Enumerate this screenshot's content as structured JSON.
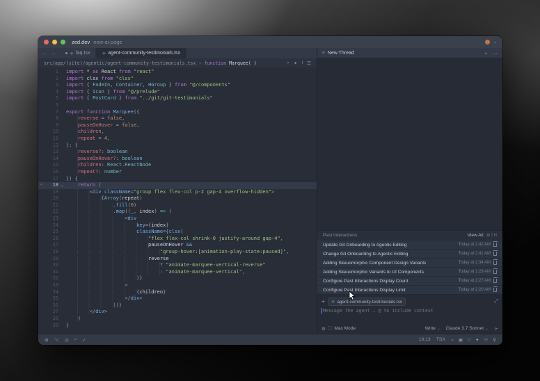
{
  "icons": {
    "back": "←",
    "forward": "→",
    "file_react": "⚛",
    "search": "⌕",
    "inline_assist": "✦",
    "cursor": "I",
    "editor_menu": "☰",
    "thread": "≡",
    "plus": "+",
    "more": "⋯",
    "expand": "⤢",
    "gear": "⚙",
    "max_mode": "⛶",
    "chevron_down": "⌄",
    "send": "➢",
    "avatar_chevron": "⌄",
    "fold_chevron": "⌄",
    "active_marker": "➤"
  },
  "titlebar": {
    "app": "zed.dev",
    "doc": "new-ai-page"
  },
  "tabs": [
    {
      "label": "faq.tsx",
      "modified": true,
      "active": false
    },
    {
      "label": "agent-community-testimonials.tsx",
      "modified": false,
      "active": true
    }
  ],
  "breadcrumb": {
    "path": "src/app/(site)/agentic/agent-community-testimonials.tsx",
    "separator": "›",
    "symbol_keyword": "function",
    "symbol_name": "Marquee( )"
  },
  "editor": {
    "lines": [
      {
        "n": 1,
        "t": [
          [
            "k",
            "import"
          ],
          [
            "v",
            " * "
          ],
          [
            "k",
            "as"
          ],
          [
            "v",
            " React "
          ],
          [
            "k",
            "from"
          ],
          [
            "s",
            " \"react\""
          ]
        ]
      },
      {
        "n": 2,
        "t": [
          [
            "k",
            "import"
          ],
          [
            "v",
            " clsx "
          ],
          [
            "k",
            "from"
          ],
          [
            "s",
            " \"clsx\""
          ]
        ]
      },
      {
        "n": 3,
        "t": [
          [
            "k",
            "import"
          ],
          [
            "g",
            " { "
          ],
          [
            "t",
            "FadeIn"
          ],
          [
            "g",
            ", "
          ],
          [
            "t",
            "Container"
          ],
          [
            "g",
            ", "
          ],
          [
            "t",
            "HGroup"
          ],
          [
            "g",
            " } "
          ],
          [
            "k",
            "from"
          ],
          [
            "s",
            " \"@/components\""
          ]
        ]
      },
      {
        "n": 4,
        "t": [
          [
            "k",
            "import"
          ],
          [
            "g",
            " { "
          ],
          [
            "t",
            "Icon"
          ],
          [
            "g",
            " } "
          ],
          [
            "k",
            "from"
          ],
          [
            "s",
            " \"@/prelude\""
          ]
        ]
      },
      {
        "n": 5,
        "t": [
          [
            "k",
            "import"
          ],
          [
            "g",
            " { "
          ],
          [
            "t",
            "PostCard"
          ],
          [
            "g",
            " } "
          ],
          [
            "k",
            "from"
          ],
          [
            "s",
            " \"../git/git-testimonials\""
          ]
        ]
      },
      {
        "n": 6,
        "t": []
      },
      {
        "n": 7,
        "t": [
          [
            "k",
            "export"
          ],
          [
            "k",
            " function"
          ],
          [
            "f",
            " Marquee"
          ],
          [
            "g",
            "({"
          ]
        ]
      },
      {
        "n": 8,
        "t": [
          [
            "i",
            "    "
          ],
          [
            "p",
            "reverse"
          ],
          [
            "g",
            " = "
          ],
          [
            "n",
            "false"
          ],
          [
            "g",
            ","
          ]
        ]
      },
      {
        "n": 9,
        "t": [
          [
            "i",
            "    "
          ],
          [
            "p",
            "pauseOnHover"
          ],
          [
            "g",
            " = "
          ],
          [
            "n",
            "false"
          ],
          [
            "g",
            ","
          ]
        ]
      },
      {
        "n": 10,
        "t": [
          [
            "i",
            "    "
          ],
          [
            "p",
            "children"
          ],
          [
            "g",
            ","
          ]
        ]
      },
      {
        "n": 11,
        "t": [
          [
            "i",
            "    "
          ],
          [
            "p",
            "repeat"
          ],
          [
            "g",
            " = "
          ],
          [
            "n",
            "4"
          ],
          [
            "g",
            ","
          ]
        ]
      },
      {
        "n": 12,
        "t": [
          [
            "g",
            "}: {"
          ]
        ]
      },
      {
        "n": 13,
        "t": [
          [
            "i",
            "    "
          ],
          [
            "p",
            "reverse?"
          ],
          [
            "g",
            ": "
          ],
          [
            "t",
            "boolean"
          ]
        ]
      },
      {
        "n": 14,
        "t": [
          [
            "i",
            "    "
          ],
          [
            "p",
            "pauseOnHover?"
          ],
          [
            "g",
            ": "
          ],
          [
            "t",
            "boolean"
          ]
        ]
      },
      {
        "n": 15,
        "t": [
          [
            "i",
            "    "
          ],
          [
            "p",
            "children"
          ],
          [
            "g",
            ": "
          ],
          [
            "t",
            "React.ReactNode"
          ]
        ]
      },
      {
        "n": 16,
        "t": [
          [
            "i",
            "    "
          ],
          [
            "p",
            "repeat?"
          ],
          [
            "g",
            ": "
          ],
          [
            "t",
            "number"
          ]
        ]
      },
      {
        "n": 17,
        "t": [
          [
            "g",
            "}) {"
          ]
        ]
      },
      {
        "n": 18,
        "hl": true,
        "t": [
          [
            "i",
            "    "
          ],
          [
            "k",
            "return"
          ],
          [
            "g",
            " ("
          ]
        ]
      },
      {
        "n": 19,
        "t": [
          [
            "i",
            "        "
          ],
          [
            "g",
            "<"
          ],
          [
            "f",
            "div"
          ],
          [
            "v",
            " "
          ],
          [
            "a",
            "className"
          ],
          [
            "g",
            "="
          ],
          [
            "s",
            "\"group flex flex-col p-2 gap-4 overflow-hidden\""
          ],
          [
            "g",
            ">"
          ]
        ]
      },
      {
        "n": 20,
        "t": [
          [
            "i",
            "            "
          ],
          [
            "g",
            "{"
          ],
          [
            "t",
            "Array"
          ],
          [
            "g",
            "("
          ],
          [
            "v",
            "repeat"
          ],
          [
            "g",
            ")"
          ]
        ]
      },
      {
        "n": 21,
        "t": [
          [
            "i",
            "                "
          ],
          [
            "g",
            "."
          ],
          [
            "f",
            "fill"
          ],
          [
            "g",
            "("
          ],
          [
            "n",
            "0"
          ],
          [
            "g",
            ")"
          ]
        ]
      },
      {
        "n": 22,
        "t": [
          [
            "i",
            "                "
          ],
          [
            "g",
            "."
          ],
          [
            "f",
            "map"
          ],
          [
            "g",
            "(("
          ],
          [
            "v",
            "_"
          ],
          [
            "g",
            ", "
          ],
          [
            "v",
            "index"
          ],
          [
            "g",
            ") "
          ],
          [
            "o",
            "=>"
          ],
          [
            "g",
            " ("
          ]
        ]
      },
      {
        "n": 23,
        "t": [
          [
            "i",
            "                    "
          ],
          [
            "g",
            "<"
          ],
          [
            "f",
            "div"
          ]
        ]
      },
      {
        "n": 24,
        "t": [
          [
            "i",
            "                        "
          ],
          [
            "a",
            "key"
          ],
          [
            "g",
            "={"
          ],
          [
            "v",
            "index"
          ],
          [
            "g",
            "}"
          ]
        ]
      },
      {
        "n": 25,
        "t": [
          [
            "i",
            "                        "
          ],
          [
            "a",
            "className"
          ],
          [
            "g",
            "={"
          ],
          [
            "f",
            "clsx"
          ],
          [
            "g",
            "("
          ]
        ]
      },
      {
        "n": 26,
        "t": [
          [
            "i",
            "                            "
          ],
          [
            "s",
            "\"flex flex-col shrink-0 justify-around gap-4\""
          ],
          [
            "g",
            ","
          ]
        ]
      },
      {
        "n": 27,
        "t": [
          [
            "i",
            "                            "
          ],
          [
            "v",
            "pauseOnHover"
          ],
          [
            "o",
            " &&"
          ]
        ]
      },
      {
        "n": 28,
        "t": [
          [
            "i",
            "                                "
          ],
          [
            "s",
            "\"group-hover:[animation-play-state:paused]\""
          ],
          [
            "g",
            ","
          ]
        ]
      },
      {
        "n": 29,
        "t": [
          [
            "i",
            "                            "
          ],
          [
            "v",
            "reverse"
          ]
        ]
      },
      {
        "n": 30,
        "t": [
          [
            "i",
            "                                "
          ],
          [
            "o",
            "? "
          ],
          [
            "s",
            "\"animate-marquee-vertical-reverse\""
          ]
        ]
      },
      {
        "n": 31,
        "t": [
          [
            "i",
            "                                "
          ],
          [
            "o",
            ": "
          ],
          [
            "s",
            "\"animate-marquee-vertical\""
          ],
          [
            "g",
            ","
          ]
        ]
      },
      {
        "n": 32,
        "t": [
          [
            "i",
            "                        "
          ],
          [
            "g",
            ")}"
          ]
        ]
      },
      {
        "n": 33,
        "t": [
          [
            "i",
            "                    "
          ],
          [
            "g",
            ">"
          ]
        ]
      },
      {
        "n": 34,
        "t": [
          [
            "i",
            "                        "
          ],
          [
            "g",
            "{"
          ],
          [
            "v",
            "children"
          ],
          [
            "g",
            "}"
          ]
        ]
      },
      {
        "n": 35,
        "t": [
          [
            "i",
            "                    "
          ],
          [
            "g",
            "</"
          ],
          [
            "f",
            "div"
          ],
          [
            "g",
            ">"
          ]
        ]
      },
      {
        "n": 36,
        "t": [
          [
            "i",
            "                "
          ],
          [
            "g",
            "))}"
          ]
        ]
      },
      {
        "n": 37,
        "t": [
          [
            "i",
            "        "
          ],
          [
            "g",
            "</"
          ],
          [
            "f",
            "div"
          ],
          [
            "g",
            ">"
          ]
        ]
      },
      {
        "n": 38,
        "t": [
          [
            "i",
            "    "
          ],
          [
            "g",
            ")"
          ]
        ]
      },
      {
        "n": 39,
        "t": [
          [
            "g",
            "}"
          ]
        ]
      }
    ]
  },
  "panel": {
    "header": {
      "title": "New Thread"
    },
    "past": {
      "title": "Past Interactions",
      "view_all": "View All",
      "shortcut": "⌘⇧H",
      "items": [
        {
          "title": "Update Git Onboarding to Agentic Editing",
          "time": "Today at 2:42 AM"
        },
        {
          "title": "Change Git Onboarding to Agentic Editing",
          "time": "Today at 2:41 AM"
        },
        {
          "title": "Adding Skeuomorphic Component Design Variants",
          "time": "Today at 2:34 AM"
        },
        {
          "title": "Adding Skeuomorphic Variants to UI Components",
          "time": "Today at 2:29 AM"
        },
        {
          "title": "Configure Past Interactions Display Count",
          "time": "Today at 2:27 AM"
        },
        {
          "title": "Configure Past Interactions Display Limit",
          "time": "Today at 2:20 AM"
        }
      ]
    },
    "composer": {
      "context_chip": "agent-community-testimonials.tsx",
      "placeholder": "Message the agent — @ to include context",
      "max_mode_label": "Max Mode",
      "mode_label": "Write",
      "model_label": "Claude 3.7 Sonnet"
    }
  },
  "statusbar": {
    "time": "18:13",
    "language": "TSX",
    "left_icons": [
      {
        "name": "project-panel-icon",
        "glyph": "⊞"
      },
      {
        "name": "git-branch-icon",
        "glyph": "⌥"
      },
      {
        "name": "diagnostics-icon",
        "glyph": "◎"
      },
      {
        "name": "search-icon",
        "glyph": "⌕"
      },
      {
        "name": "check-icon",
        "glyph": "✓"
      }
    ],
    "right_icons": [
      {
        "name": "edit-prediction-icon",
        "glyph": "⌁",
        "accent": false
      },
      {
        "name": "terminal-icon",
        "glyph": "▣",
        "accent": false
      },
      {
        "name": "docs-icon",
        "glyph": "□",
        "accent": false
      },
      {
        "name": "assistant-icon",
        "glyph": "✦",
        "accent": true
      },
      {
        "name": "collab-icon",
        "glyph": "⚇",
        "accent": false
      },
      {
        "name": "mic-icon",
        "glyph": "⚲",
        "accent": false
      }
    ]
  },
  "colors": {
    "accent_blue": "#6ca6e8",
    "traffic_red": "#ec6a5e",
    "traffic_yellow": "#f4bf4f",
    "traffic_green": "#61c554"
  }
}
